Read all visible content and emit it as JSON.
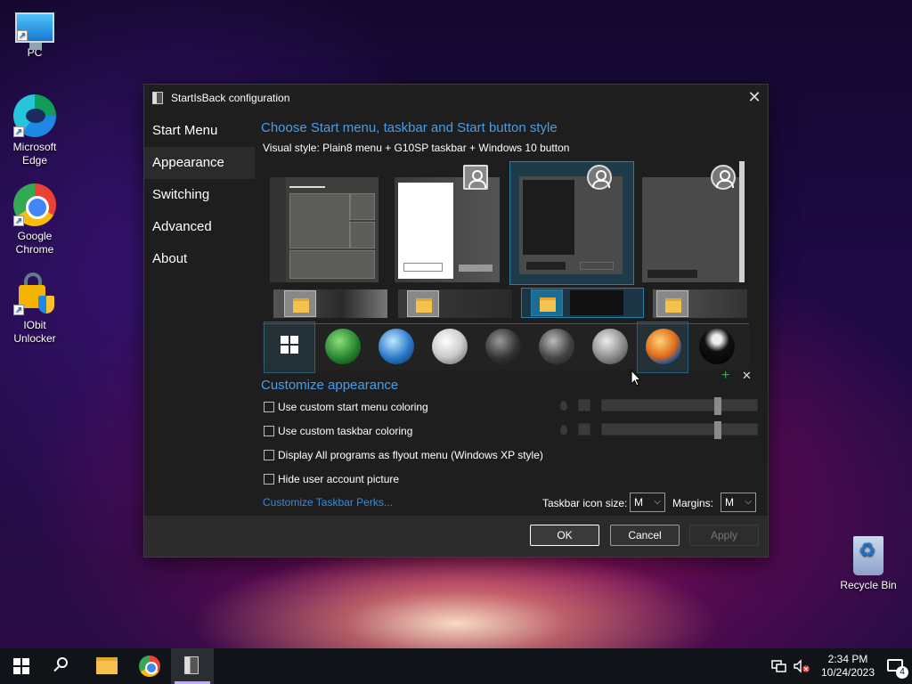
{
  "desktop": {
    "icons": [
      {
        "label": "PC"
      },
      {
        "label": "Microsoft Edge"
      },
      {
        "label": "Google Chrome"
      },
      {
        "label": "IObit Unlocker"
      },
      {
        "label": "Recycle Bin"
      }
    ]
  },
  "dialog": {
    "title": "StartIsBack configuration",
    "close_glyph": "✕",
    "nav": [
      "Start Menu",
      "Appearance",
      "Switching",
      "Advanced",
      "About"
    ],
    "active_nav": "Appearance",
    "style_section": {
      "title": "Choose Start menu, taskbar and Start button style",
      "visual_style_label": "Visual style:",
      "visual_style_value": "Plain8 menu + G10SP taskbar + Windows 10 button"
    },
    "customize_section": {
      "title": "Customize appearance",
      "checkboxes": [
        {
          "label": "Use custom start menu coloring",
          "checked": false
        },
        {
          "label": "Use custom taskbar coloring",
          "checked": false
        },
        {
          "label": "Display All programs as flyout menu (Windows XP style)",
          "checked": false
        },
        {
          "label": "Hide user account picture",
          "checked": false
        }
      ],
      "link": "Customize Taskbar Perks...",
      "taskbar_icon_size_label": "Taskbar icon size:",
      "taskbar_icon_size_value": "M",
      "margins_label": "Margins:",
      "margins_value": "M",
      "add_glyph": "+",
      "remove_glyph": "✕"
    },
    "buttons": {
      "ok": "OK",
      "cancel": "Cancel",
      "apply": "Apply"
    }
  },
  "taskbar": {
    "time": "2:34 PM",
    "date": "10/24/2023",
    "notification_count": "4",
    "accent_color": "#c5a6ff"
  }
}
